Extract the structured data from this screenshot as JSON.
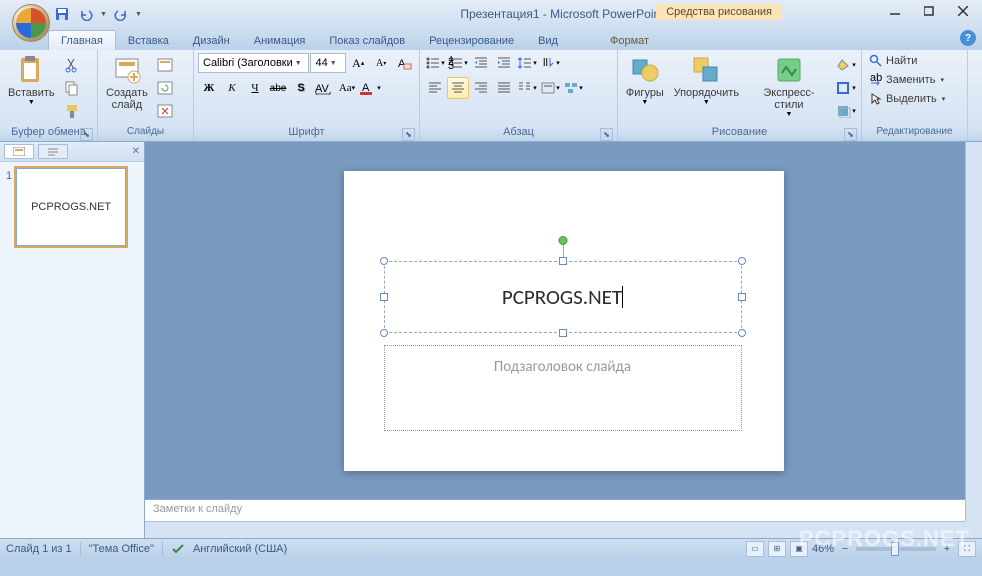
{
  "title": "Презентация1 - Microsoft PowerPoint",
  "context_tool": "Средства рисования",
  "tabs": [
    "Главная",
    "Вставка",
    "Дизайн",
    "Анимация",
    "Показ слайдов",
    "Рецензирование",
    "Вид"
  ],
  "context_tab": "Формат",
  "ribbon": {
    "clipboard": {
      "label": "Буфер обмена",
      "paste": "Вставить"
    },
    "slides": {
      "label": "Слайды",
      "new_slide": "Создать\nслайд"
    },
    "font": {
      "label": "Шрифт",
      "name": "Calibri (Заголовки",
      "size": "44"
    },
    "paragraph": {
      "label": "Абзац"
    },
    "drawing": {
      "label": "Рисование",
      "shapes": "Фигуры",
      "arrange": "Упорядочить",
      "quick_styles": "Экспресс-стили"
    },
    "editing": {
      "label": "Редактирование",
      "find": "Найти",
      "replace": "Заменить",
      "select": "Выделить"
    }
  },
  "slide": {
    "title_text": "PCPROGS.NET",
    "subtitle_placeholder": "Подзаголовок слайда",
    "thumb_text": "PCPROGS.NET",
    "thumb_number": "1"
  },
  "notes_placeholder": "Заметки к слайду",
  "status": {
    "slide_info": "Слайд 1 из 1",
    "theme": "\"Тема Office\"",
    "language": "Английский (США)",
    "zoom": "46%"
  },
  "watermark": "PCPROGS.NET"
}
